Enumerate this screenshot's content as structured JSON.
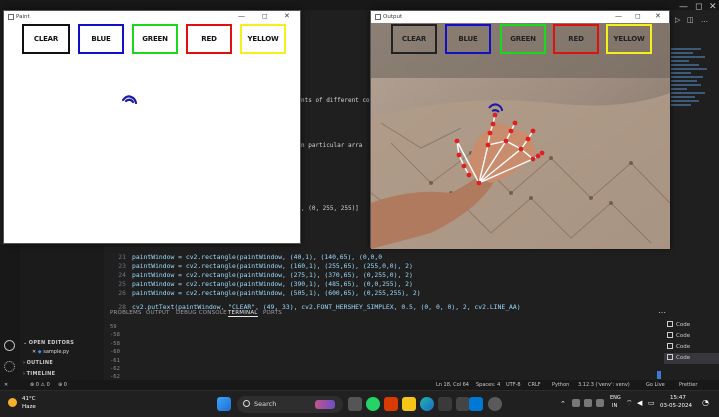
{
  "paint_window": {
    "title": "Paint",
    "min": "—",
    "max": "◻",
    "close": "✕"
  },
  "output_window": {
    "title": "Output",
    "min": "—",
    "max": "◻",
    "close": "✕"
  },
  "color_buttons": [
    {
      "label": "CLEAR",
      "color": "#000000"
    },
    {
      "label": "BLUE",
      "color": "#0000ff"
    },
    {
      "label": "GREEN",
      "color": "#00ff00"
    },
    {
      "label": "RED",
      "color": "#ff0000"
    },
    {
      "label": "YELLOW",
      "color": "#ffff00"
    }
  ],
  "code": {
    "fragments": {
      "drawn_text": "nts of different co",
      "particular": "n particular arra",
      "color_tuple": ", (0, 255, 255)]"
    },
    "lines": [
      {
        "num": "21",
        "text": "paintWindow = cv2.rectangle(paintWindow, (40,1), (140,65), (0,0,0"
      },
      {
        "num": "23",
        "text": "paintWindow = cv2.rectangle(paintWindow, (160,1), (255,65), (255,0,0), 2)"
      },
      {
        "num": "24",
        "text": "paintWindow = cv2.rectangle(paintWindow, (275,1), (370,65), (0,255,0), 2)"
      },
      {
        "num": "25",
        "text": "paintWindow = cv2.rectangle(paintWindow, (390,1), (485,65), (0,0,255), 2)"
      },
      {
        "num": "26",
        "text": "paintWindow = cv2.rectangle(paintWindow, (505,1), (600,65), (0,255,255), 2)"
      },
      {
        "num": "28",
        "text": "cv2.putText(paintWindow, \"CLEAR\", (49, 33), cv2.FONT_HERSHEY_SIMPLEX, 0.5, (0, 0, 0), 2, cv2.LINE_AA)"
      }
    ]
  },
  "panel": {
    "tabs": [
      "PROBLEMS",
      "OUTPUT",
      "DEBUG CONSOLE",
      "TERMINAL",
      "PORTS"
    ],
    "active_tab": "TERMINAL",
    "terminal_lines": [
      "59",
      "-58",
      "-58",
      "-60",
      "-61",
      "-62",
      "-62"
    ],
    "terminal_list": [
      "Code",
      "Code",
      "Code",
      "Code"
    ]
  },
  "sidebar": {
    "open_editors": "OPEN EDITORS",
    "file": "sample.py",
    "outline": "OUTLINE",
    "timeline": "TIMELINE"
  },
  "status_bar": {
    "errors": "⊗ 0 ⚠ 0",
    "ports": "⊕ 0",
    "position": "Ln 18, Col 64",
    "spaces": "Spaces: 4",
    "encoding": "UTF-8",
    "eol": "CRLF",
    "language": "Python",
    "interpreter": "3.12.3 ('venv': venv)",
    "golive": "Go Live",
    "prettier": "Prettier"
  },
  "taskbar": {
    "temperature": "41°C",
    "weather": "Haze",
    "search": "Search",
    "lang_top": "ENG",
    "lang_bottom": "IN",
    "time": "15:47",
    "date": "03-05-2024"
  }
}
